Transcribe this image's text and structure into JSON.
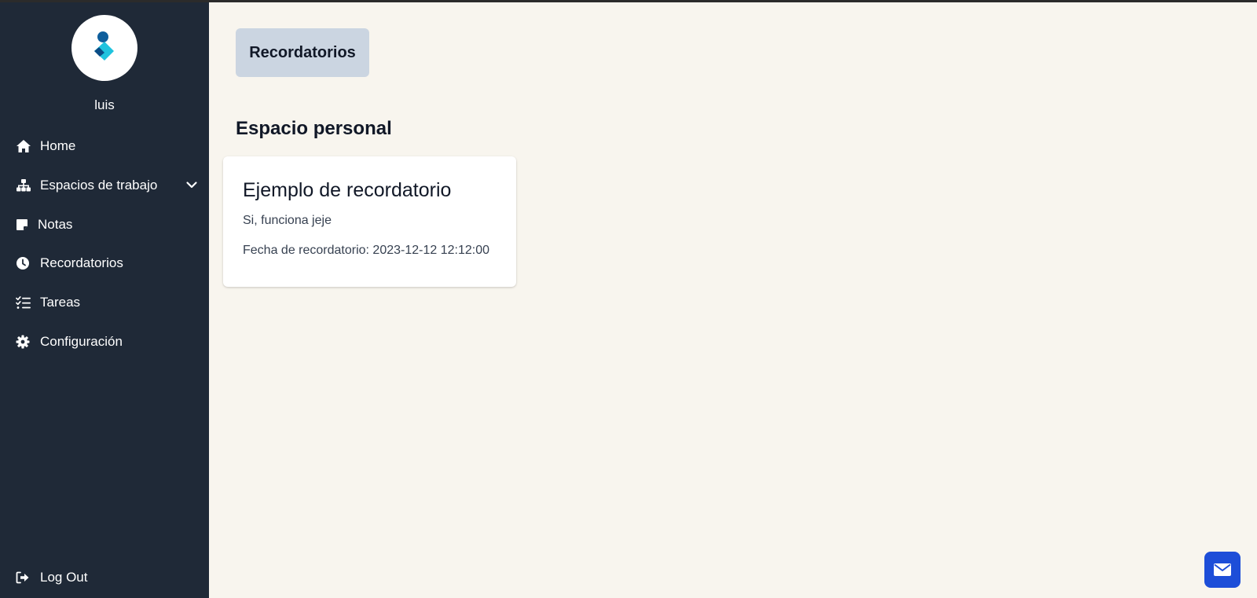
{
  "user": {
    "name": "luis"
  },
  "sidebar": {
    "items": [
      {
        "label": "Home",
        "icon": "home-icon"
      },
      {
        "label": "Espacios de trabajo",
        "icon": "sitemap-icon",
        "expandable": true
      },
      {
        "label": "Notas",
        "icon": "note-icon"
      },
      {
        "label": "Recordatorios",
        "icon": "clock-icon"
      },
      {
        "label": "Tareas",
        "icon": "task-list-icon"
      },
      {
        "label": "Configuración",
        "icon": "gear-icon"
      }
    ],
    "logout_label": "Log Out"
  },
  "main": {
    "tab_label": "Recordatorios",
    "section_title": "Espacio personal",
    "reminders": [
      {
        "title": "Ejemplo de recordatorio",
        "description": "Si, funciona jeje",
        "date_text": "Fecha de recordatorio: 2023-12-12 12:12:00"
      }
    ]
  },
  "colors": {
    "sidebar_bg": "#1f2937",
    "main_bg": "#f8f5ee",
    "tab_bg": "#cbd5e1",
    "mail_button": "#1d4ed8"
  }
}
